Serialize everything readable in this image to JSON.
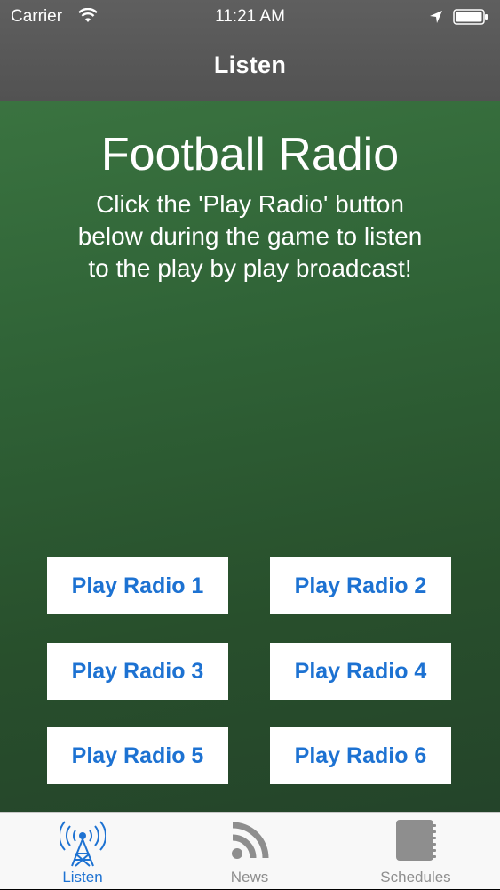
{
  "status_bar": {
    "carrier": "Carrier",
    "time": "11:21 AM"
  },
  "nav": {
    "title": "Listen"
  },
  "main": {
    "heading": "Football Radio",
    "description": "Click the 'Play Radio' button below during the game to listen to the play by play broadcast!"
  },
  "buttons": [
    {
      "label": "Play Radio 1"
    },
    {
      "label": "Play Radio 2"
    },
    {
      "label": "Play Radio 3"
    },
    {
      "label": "Play Radio 4"
    },
    {
      "label": "Play Radio 5"
    },
    {
      "label": "Play Radio 6"
    }
  ],
  "tabs": [
    {
      "label": "Listen",
      "icon": "radio-tower-icon",
      "active": true
    },
    {
      "label": "News",
      "icon": "rss-feed-icon",
      "active": false
    },
    {
      "label": "Schedules",
      "icon": "notebook-icon",
      "active": false
    }
  ],
  "colors": {
    "accent": "#1d72d2",
    "nav_bg": "#5a5a5a",
    "main_bg": "#2f6236",
    "tab_inactive": "#8e8e8e"
  }
}
